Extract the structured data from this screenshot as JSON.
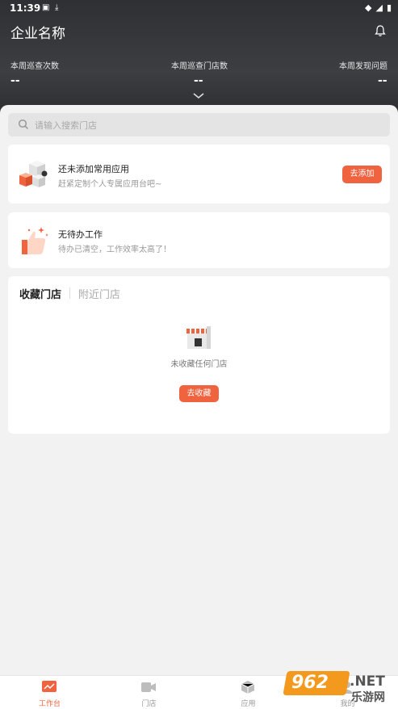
{
  "status": {
    "time": "11:39"
  },
  "header": {
    "company_name": "企业名称",
    "stats": [
      {
        "label": "本周巡查次数",
        "value": "--"
      },
      {
        "label": "本周巡查门店数",
        "value": "--"
      },
      {
        "label": "本周发现问题",
        "value": "--"
      }
    ]
  },
  "search": {
    "placeholder": "请输入搜索门店"
  },
  "apps_card": {
    "title": "还未添加常用应用",
    "subtitle": "赶紧定制个人专属应用台吧~",
    "button": "去添加"
  },
  "todo_card": {
    "title": "无待办工作",
    "subtitle": "待办已清空，工作效率太高了！"
  },
  "stores_card": {
    "tabs": [
      "收藏门店",
      "附近门店"
    ],
    "empty_text": "未收藏任何门店",
    "button": "去收藏"
  },
  "bottom_nav": [
    {
      "label": "工作台",
      "active": true
    },
    {
      "label": "门店",
      "active": false
    },
    {
      "label": "应用",
      "active": false
    },
    {
      "label": "我的",
      "active": false
    }
  ],
  "watermark": {
    "number": "962",
    "suffix": ".NET",
    "text": "乐游网"
  },
  "colors": {
    "accent": "#f0633f",
    "header_bg": "#3a3b3e",
    "page_bg": "#f2f2f2"
  }
}
